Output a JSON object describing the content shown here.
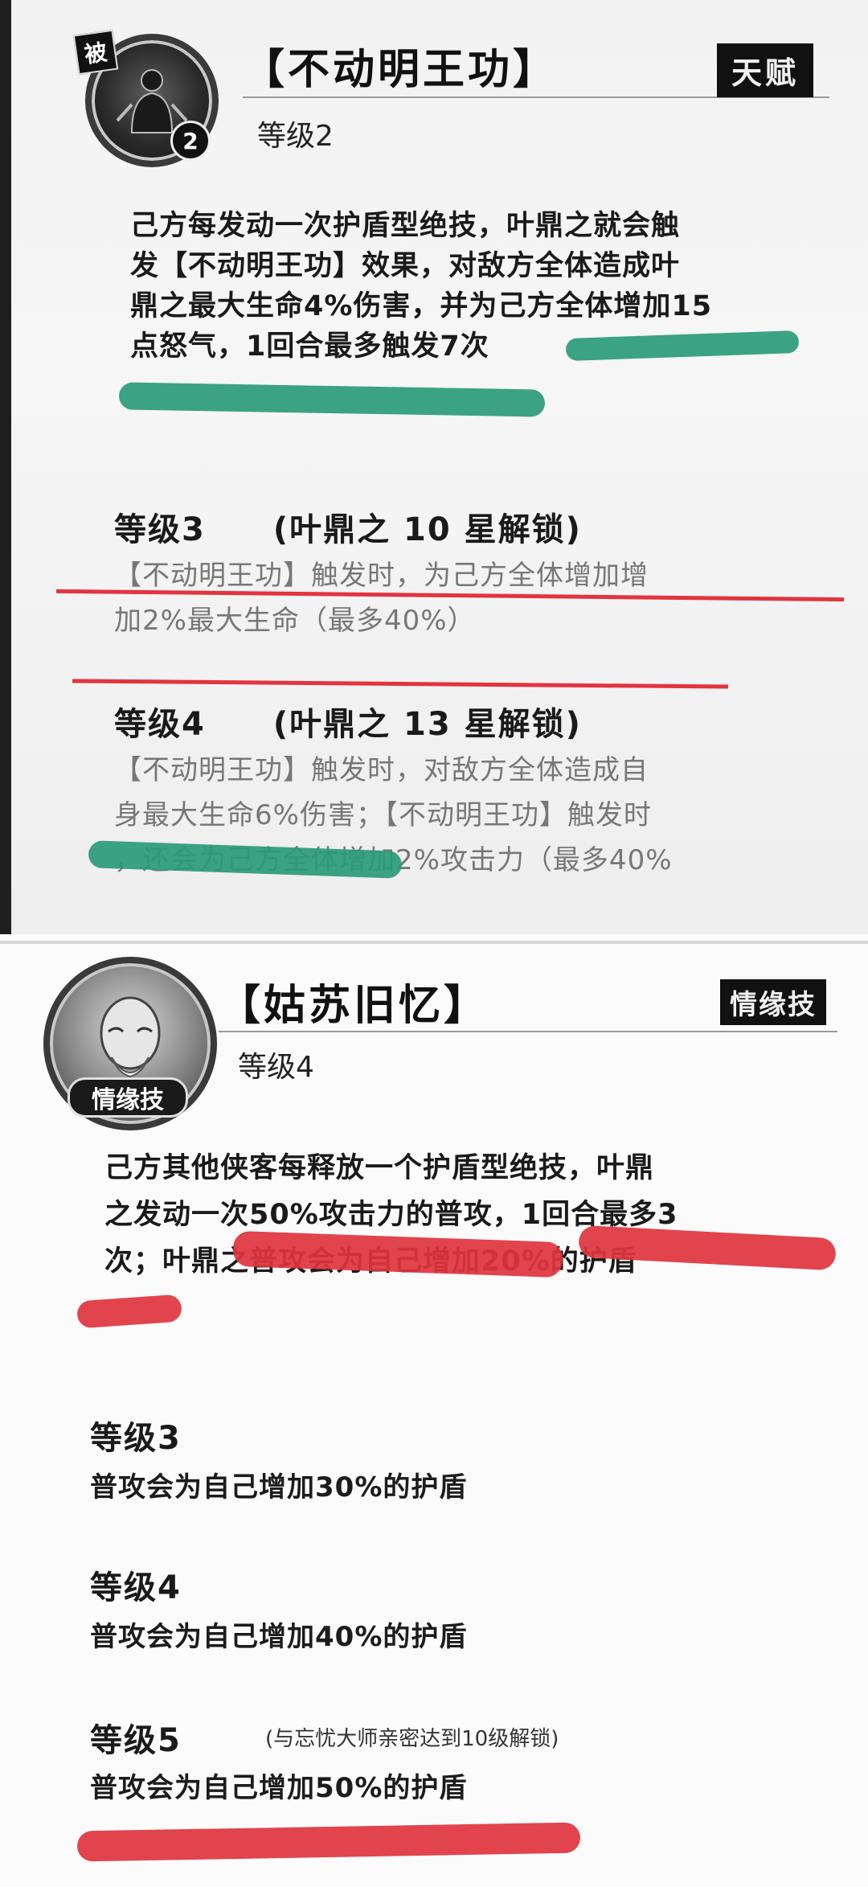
{
  "panel1": {
    "avatar_badge": "被",
    "avatar_level": "2",
    "title": "【不动明王功】",
    "level": "等级2",
    "tag": "天赋",
    "description": "己方每发动一次护盾型绝技，叶鼎之就会触发【不动明王功】效果，对敌方全体造成叶鼎之最大生命4%伤害，并为己方全体增加15点怒气，1回合最多触发7次",
    "desc_lines": [
      "己方每发动一次护盾型绝技，叶鼎之就会触",
      "发【不动明王功】效果，对敌方全体造成叶",
      "鼎之最大生命4%伤害，并为己方全体增加15",
      "点怒气，1回合最多触发7次"
    ],
    "level3_head": "等级3　　(叶鼎之 10 星解锁)",
    "level3_lines": [
      "【不动明王功】触发时，为己方全体增加增",
      "加2%最大生命（最多40%）"
    ],
    "level4_head": "等级4　　(叶鼎之 13 星解锁)",
    "level4_lines": [
      "【不动明王功】触发时，对敌方全体造成自",
      "身最大生命6%伤害；【不动明王功】触发时",
      "，还会为己方全体增加2%攻击力（最多40%"
    ]
  },
  "panel2": {
    "avatar_label": "情缘技",
    "title": "【姑苏旧忆】",
    "level": "等级4",
    "tag": "情缘技",
    "desc_lines": [
      "己方其他侠客每释放一个护盾型绝技，叶鼎",
      "之发动一次50%攻击力的普攻，1回合最多3",
      "次；叶鼎之普攻会为自己增加20%的护盾"
    ],
    "levels": [
      {
        "head": "等级3",
        "body": "普攻会为自己增加30%的护盾"
      },
      {
        "head": "等级4",
        "body": "普攻会为自己增加40%的护盾"
      },
      {
        "head": "等级5",
        "note": "(与忘忧大师亲密达到10级解锁)",
        "body": "普攻会为自己增加50%的护盾"
      }
    ]
  },
  "colors": {
    "green_highlight": "#2a9a78",
    "red_highlight": "#e0343e",
    "tag_bg": "#111111"
  },
  "icons": [
    "meditating-figure-icon",
    "elder-portrait-icon"
  ]
}
